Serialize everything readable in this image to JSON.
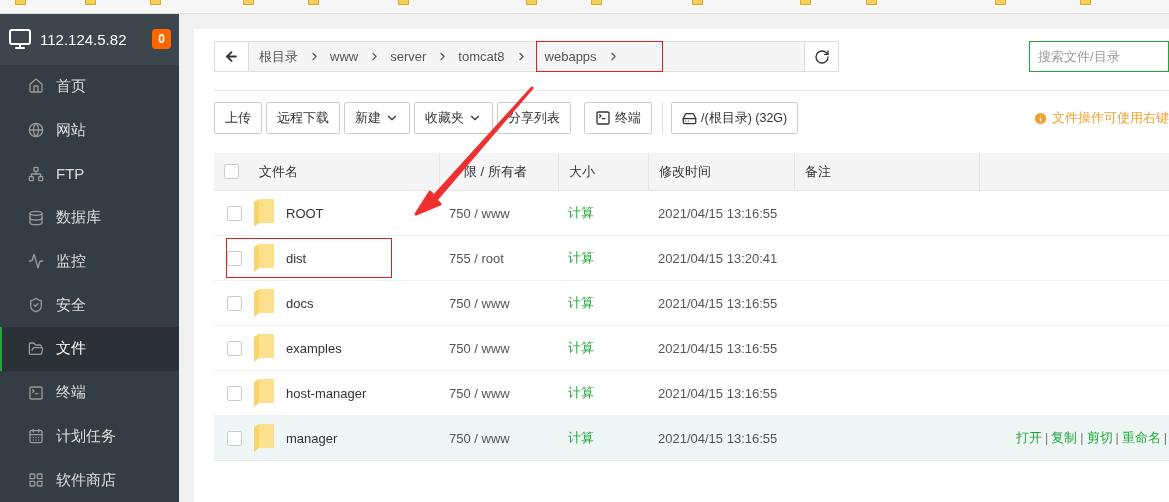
{
  "sidebar": {
    "host": "112.124.5.82",
    "badge": "0",
    "items": [
      {
        "label": "首页",
        "selected": false
      },
      {
        "label": "网站",
        "selected": false
      },
      {
        "label": "FTP",
        "selected": false
      },
      {
        "label": "数据库",
        "selected": false
      },
      {
        "label": "监控",
        "selected": false
      },
      {
        "label": "安全",
        "selected": false
      },
      {
        "label": "文件",
        "selected": true
      },
      {
        "label": "终端",
        "selected": false
      },
      {
        "label": "计划任务",
        "selected": false
      },
      {
        "label": "软件商店",
        "selected": false
      }
    ]
  },
  "breadcrumb": [
    {
      "label": "根目录",
      "highlighted": false
    },
    {
      "label": "www",
      "highlighted": false
    },
    {
      "label": "server",
      "highlighted": false
    },
    {
      "label": "tomcat8",
      "highlighted": false
    },
    {
      "label": "webapps",
      "highlighted": true
    }
  ],
  "search": {
    "placeholder": "搜索文件/目录"
  },
  "toolbar": [
    {
      "label": "上传",
      "kind": "plain"
    },
    {
      "label": "远程下载",
      "kind": "plain"
    },
    {
      "label": "新建",
      "kind": "dropdown"
    },
    {
      "label": "收藏夹",
      "kind": "dropdown"
    },
    {
      "label": "分享列表",
      "kind": "plain"
    },
    {
      "label": "终端",
      "kind": "terminal"
    },
    {
      "label": "/(根目录) (32G)",
      "kind": "disk"
    }
  ],
  "hint": "文件操作可使用右键",
  "table": {
    "columns": [
      "文件名",
      "限 / 所有者",
      "大小",
      "修改时间",
      "备注"
    ],
    "header_checked": false,
    "rows": [
      {
        "name": "ROOT",
        "perm": "750 / www",
        "size": "计算",
        "time": "2021/04/15 13:16:55",
        "checked": false,
        "selected": false,
        "highlighted": false
      },
      {
        "name": "dist",
        "perm": "755 / root",
        "size": "计算",
        "time": "2021/04/15 13:20:41",
        "checked": false,
        "selected": false,
        "highlighted": true
      },
      {
        "name": "docs",
        "perm": "750 / www",
        "size": "计算",
        "time": "2021/04/15 13:16:55",
        "checked": false,
        "selected": false,
        "highlighted": false
      },
      {
        "name": "examples",
        "perm": "750 / www",
        "size": "计算",
        "time": "2021/04/15 13:16:55",
        "checked": false,
        "selected": false,
        "highlighted": false
      },
      {
        "name": "host-manager",
        "perm": "750 / www",
        "size": "计算",
        "time": "2021/04/15 13:16:55",
        "checked": false,
        "selected": false,
        "highlighted": false
      },
      {
        "name": "manager",
        "perm": "750 / www",
        "size": "计算",
        "time": "2021/04/15 13:16:55",
        "checked": false,
        "selected": true,
        "highlighted": false,
        "actions": [
          "打开",
          "复制",
          "剪切",
          "重命名"
        ]
      }
    ]
  },
  "action_separator": "|",
  "annotation_arrow": true
}
